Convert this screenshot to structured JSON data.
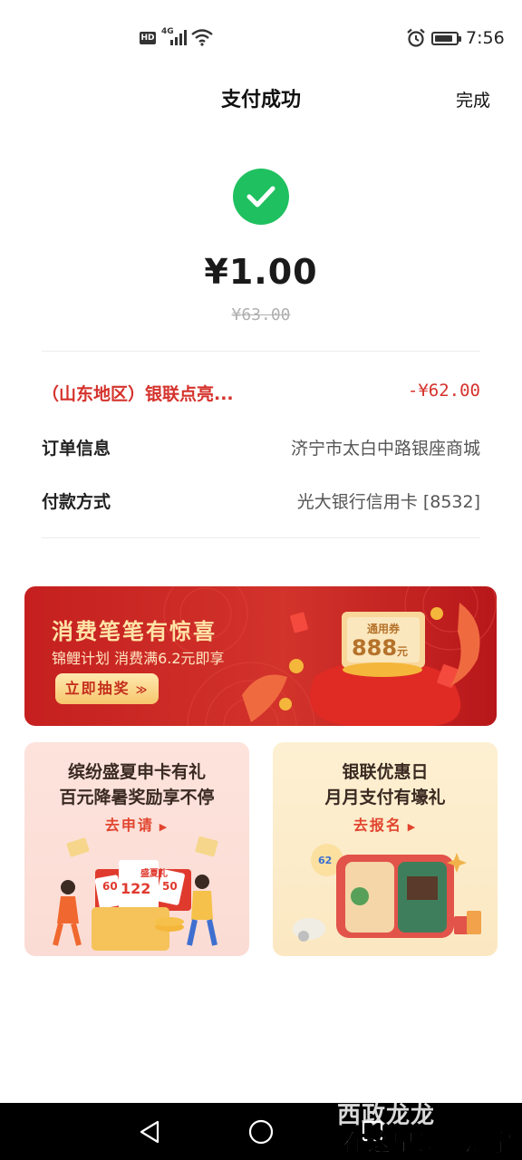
{
  "status_bar": {
    "hd": "HD",
    "network": "4G",
    "time": "7:56",
    "battery_level": 0.85,
    "icons": [
      "signal-icon",
      "wifi-icon",
      "alarm-icon",
      "battery-icon"
    ]
  },
  "nav": {
    "title": "支付成功",
    "done_label": "完成"
  },
  "payment": {
    "amount": "¥1.00",
    "original_amount": "¥63.00",
    "success_color": "#1fc05f"
  },
  "details": {
    "discount_label": "（山东地区）银联点亮...",
    "discount_value": "-¥62.00",
    "order_label": "订单信息",
    "order_value": "济宁市太白中路银座商城",
    "pay_method_label": "付款方式",
    "pay_method_value": "光大银行信用卡 [8532]",
    "accent_color": "#d5322c"
  },
  "promo_banner": {
    "title": "消费笔笔有惊喜",
    "subtitle": "锦鲤计划 消费满6.2元即享",
    "button_label": "立即抽奖",
    "coupon_label": "通用券",
    "coupon_value": "888",
    "coupon_unit": "元"
  },
  "cards": [
    {
      "line1": "缤纷盛夏申卡有礼",
      "line2": "百元降暑奖励享不停",
      "link": "去申请",
      "deco": [
        "盛夏礼",
        "122",
        "60",
        "50"
      ]
    },
    {
      "line1": "银联优惠日",
      "line2": "月月支付有壕礼",
      "link": "去报名",
      "deco": [
        "62"
      ]
    }
  ],
  "system_nav": {
    "icons": [
      "back-icon",
      "home-icon",
      "recents-icon"
    ]
  },
  "watermark": {
    "line1": "西政龙龙",
    "line2": "在这里读懂济宁"
  }
}
